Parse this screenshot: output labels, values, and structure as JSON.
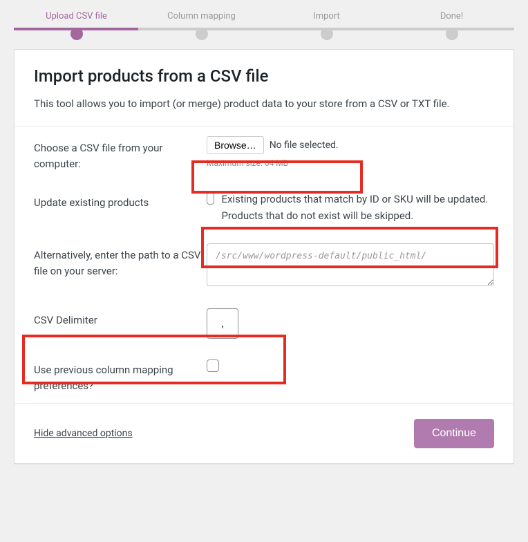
{
  "stepper": {
    "steps": [
      "Upload CSV file",
      "Column mapping",
      "Import",
      "Done!"
    ]
  },
  "header": {
    "title": "Import products from a CSV file",
    "subtitle": "This tool allows you to import (or merge) product data to your store from a CSV or TXT file."
  },
  "form": {
    "choose_label": "Choose a CSV file from your computer:",
    "browse_label": "Browse…",
    "no_file": "No file selected.",
    "max_size": "Maximum size: 64 MB",
    "update_label": "Update existing products",
    "update_desc": "Existing products that match by ID or SKU will be updated. Products that do not exist will be skipped.",
    "path_label": "Alternatively, enter the path to a CSV file on your server:",
    "path_placeholder": "/src/www/wordpress-default/public_html/",
    "delimiter_label": "CSV Delimiter",
    "delimiter_value": ",",
    "prev_mapping_label": "Use previous column mapping preferences?"
  },
  "footer": {
    "hide_advanced": "Hide advanced options",
    "continue": "Continue"
  }
}
